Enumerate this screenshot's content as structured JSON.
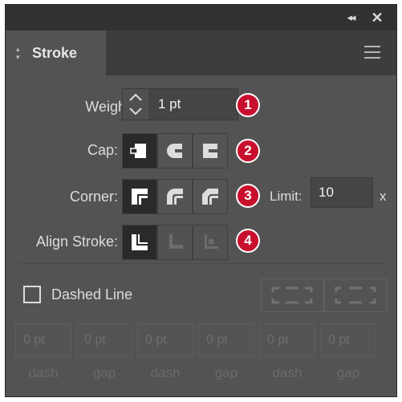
{
  "topbar": {
    "collapse_glyph": "◂◂",
    "close_glyph": "✕"
  },
  "tab": {
    "label": "Stroke",
    "chevron": "◇",
    "menu_icon": "hamburger-icon"
  },
  "weight": {
    "label": "Weight:",
    "value": "1 pt"
  },
  "cap": {
    "label": "Cap:",
    "options": [
      "butt-cap",
      "round-cap",
      "projecting-cap"
    ],
    "selected": 0
  },
  "corner": {
    "label": "Corner:",
    "options": [
      "miter-join",
      "round-join",
      "bevel-join"
    ],
    "selected": 0,
    "limit_label": "Limit:",
    "limit_value": "10",
    "limit_unit": "x"
  },
  "align_stroke": {
    "label": "Align Stroke:",
    "options": [
      "align-center",
      "align-inside",
      "align-outside"
    ],
    "selected": 0
  },
  "badges": [
    "1",
    "2",
    "3",
    "4"
  ],
  "dashed": {
    "label": "Dashed Line",
    "checked": false
  },
  "dash_cells": [
    {
      "value": "0 pt",
      "label": "dash"
    },
    {
      "value": "0 pt",
      "label": "gap"
    },
    {
      "value": "0 pt",
      "label": "dash"
    },
    {
      "value": "0 pt",
      "label": "gap"
    },
    {
      "value": "0 pt",
      "label": "dash"
    },
    {
      "value": "0 pt",
      "label": "gap"
    }
  ],
  "colors": {
    "panel": "#535353",
    "header": "#323232",
    "badge": "#c8102e",
    "selected_button": "#2a2a2a"
  }
}
